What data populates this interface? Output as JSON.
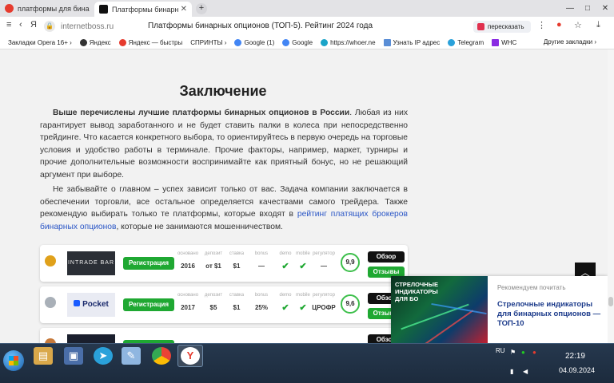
{
  "browser": {
    "tabs": [
      {
        "label": "платформы для бинарных",
        "favicon_color": "#e63b2e"
      },
      {
        "label": "Платформы бинарных опц",
        "favicon_color": "#111111"
      }
    ],
    "new_tab": "+",
    "window_controls": [
      "—",
      "□",
      "✕"
    ],
    "url": "internetboss.ru",
    "page_title": "Платформы бинарных опционов (ТОП-5). Рейтинг 2024 года",
    "retell_label": "пересказать"
  },
  "bookmarks": {
    "items": [
      "Закладки Opera 16+ ›",
      "Яндекс",
      "Яндекс — быстры",
      "СПРИНТЫ ›",
      "Google (1)",
      "Google",
      "https://whoer.ne",
      "Узнать IP адрес",
      "Telegram",
      "WHC"
    ],
    "other": "Другие закладки ›"
  },
  "article": {
    "heading": "Заключение",
    "p1_bold": "Выше перечислены лучшие платформы бинарных опционов в России",
    "p1_rest": ". Любая из них гарантирует вывод заработанного и не будет ставить палки в колеса при непосредственно трейдинге. Что касается конкретного выбора, то ориентируйтесь в первую очередь на торговые условия и удобство работы в терминале. Прочие факторы, например, маркет, турниры и прочие дополнительные возможности воспринимайте как приятный бонус, но не решающий аргумент при выборе.",
    "p2_start": "Не забывайте о главном – успех зависит только от вас. Задача компании заключается в обеспечении торговли, все остальное определяется качествами самого трейдера. Также рекомендую выбирать только те платформы, которые входят в ",
    "p2_link": "рейтинг платящих брокеров бинарных опционов",
    "p2_end": ", которые не занимаются мошенничеством."
  },
  "table": {
    "register_label": "Регистрация",
    "review_label": "Обзор",
    "reviews_label": "Отзывы",
    "col_labels": [
      "основано",
      "депозит",
      "ставка",
      "bonus",
      "demo",
      "mobile",
      "регулятор"
    ],
    "rows": [
      {
        "broker": "INTRADE BAR",
        "medal_color": "#e0a11b",
        "founded": "2016",
        "deposit": "от $1",
        "bet": "$1",
        "bonus": "—",
        "demo": "✔",
        "mobile": "✔",
        "regulator": "—",
        "score": "9,9"
      },
      {
        "broker": "Pocket",
        "medal_color": "#a9b0b8",
        "founded": "2017",
        "deposit": "$5",
        "bet": "$1",
        "bonus": "25%",
        "demo": "✔",
        "mobile": "✔",
        "regulator": "ЦРОФР",
        "score": "9,6"
      },
      {
        "broker": "",
        "medal_color": "#c77a3b",
        "founded": "",
        "deposit": "",
        "bet": "",
        "bonus": "",
        "demo": "",
        "mobile": "",
        "regulator": "",
        "score": ""
      }
    ]
  },
  "recommend": {
    "label": "Рекомендуем почитать",
    "title": "Стрелочные индикаторы для бинарных опционов — ТОП-10",
    "image_text": "СТРЕЛОЧНЫЕ ИНДИКАТОРЫ ДЛЯ БО"
  },
  "taskbar": {
    "lang": "RU",
    "time": "22:19",
    "date": "04.09.2024"
  }
}
